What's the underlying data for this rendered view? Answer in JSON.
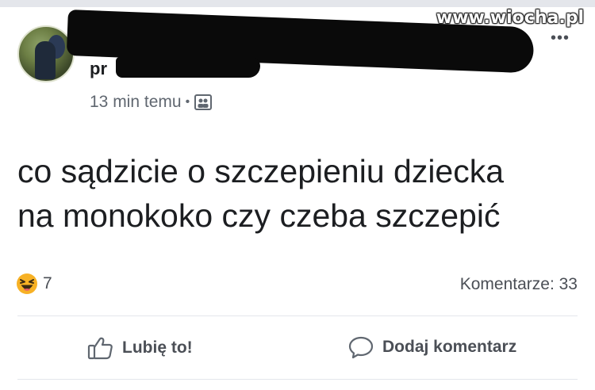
{
  "watermark": "www.wiocha.pl",
  "post": {
    "author_visible": "pr",
    "more_menu": "•••",
    "timestamp": "13 min temu",
    "separator": "•",
    "text_lines": [
      "co sądzicie  o szczepieniu dziecka",
      "na monokoko czy czeba szczepić"
    ]
  },
  "stats": {
    "reaction_icon": "haha-emoji-icon",
    "reaction_count": "7",
    "comments": "Komentarze: 33"
  },
  "actions": {
    "like_label": "Lubię to!",
    "comment_label": "Dodaj komentarz"
  },
  "colors": {
    "text": "#1c1e21",
    "secondary": "#606770",
    "divider": "#e4e6eb",
    "haha": "#f7b125"
  }
}
